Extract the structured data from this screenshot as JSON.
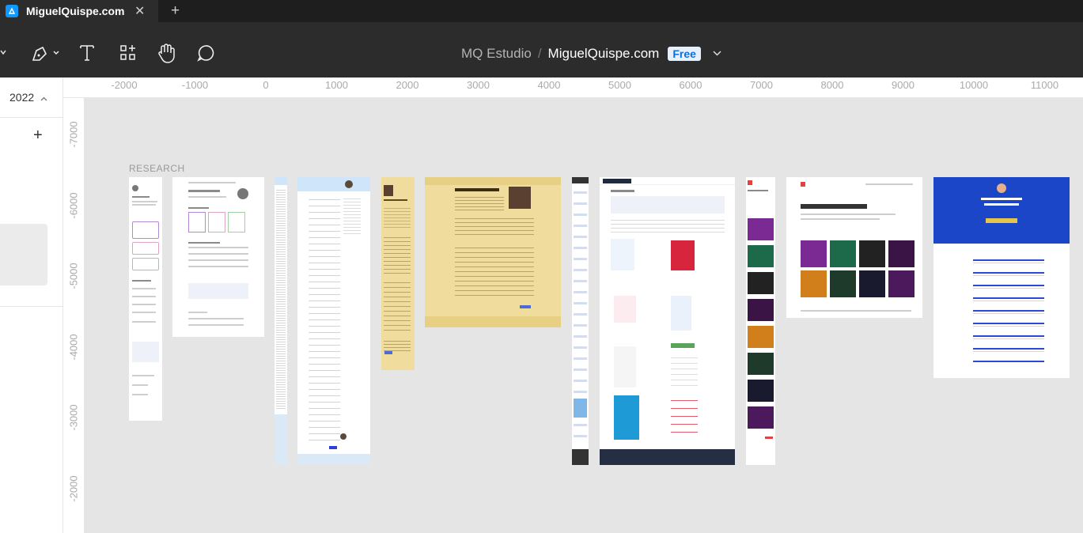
{
  "tab": {
    "title": "MiguelQuispe.com",
    "close": "✕",
    "new": "+"
  },
  "toolbar": {
    "tools": [
      "move-tool",
      "pen-tool",
      "text-tool",
      "components-tool",
      "hand-tool",
      "comment-tool"
    ],
    "team": "MQ Estudio",
    "separator": "/",
    "file": "MiguelQuispe.com",
    "plan_badge": "Free",
    "caret": "⌄"
  },
  "left_panel": {
    "page": "2022",
    "add": "+"
  },
  "ruler_top": [
    "-2000",
    "-1000",
    "0",
    "1000",
    "2000",
    "3000",
    "4000",
    "5000",
    "6000",
    "7000",
    "8000",
    "9000",
    "10000",
    "11000"
  ],
  "ruler_left": [
    "-7000",
    "-6000",
    "-5000",
    "-4000",
    "-3000",
    "-2000"
  ],
  "canvas": {
    "section_label": "RESEARCH",
    "frames": [
      {
        "title": "Lee Robinson"
      },
      {
        "title": "Lee Robinson"
      },
      {
        "title": ""
      },
      {
        "title": ""
      },
      {
        "title": "Hey, I'm Tania."
      },
      {
        "title": "Hey, I'm Tania."
      },
      {
        "title": ""
      },
      {
        "title": "Hi, I'm Chris"
      },
      {
        "title": "I make websites."
      },
      {
        "title": "I make websites."
      },
      {
        "title": "I write about visual web dev articles"
      }
    ]
  },
  "colors": {
    "accent": "#0d99ff",
    "toolbar": "#2c2c2c",
    "canvas": "#e5e5e5",
    "tania_bg": "#f0dc9d"
  }
}
